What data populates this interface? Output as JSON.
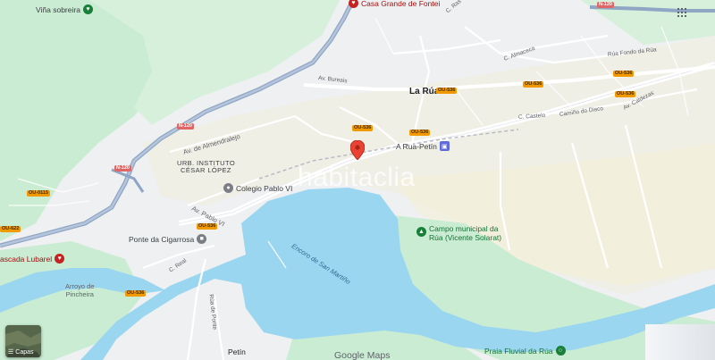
{
  "map": {
    "watermark": "habitaclia",
    "main_place": "La Rúa",
    "secondary_place": "Petín",
    "district": {
      "line1": "URB. INSTITUTO",
      "line2": "CÉSAR LÓPEZ"
    },
    "reservoir": "Encoro de San Martiño",
    "streets": [
      {
        "id": "av-bureais",
        "text": "Av. Bureais"
      },
      {
        "id": "av-almendralejo",
        "text": "Av. de Almendralejo"
      },
      {
        "id": "av-pablo-vi",
        "text": "Av. Pablo VI"
      },
      {
        "id": "c-almaceca",
        "text": "C. Almaceca"
      },
      {
        "id": "rua-fondo",
        "text": "Rúa Fondo da Rúa"
      },
      {
        "id": "c-castelo",
        "text": "C. Castelo"
      },
      {
        "id": "camino-disco",
        "text": "Camiño do Disco"
      },
      {
        "id": "av-caldezas",
        "text": "Av. Caldezas"
      },
      {
        "id": "c-real",
        "text": "C. Real"
      },
      {
        "id": "rua-ponte",
        "text": "Rúa de Ponte"
      },
      {
        "id": "c-ras",
        "text": "C. Ras"
      }
    ],
    "road_shields": [
      {
        "id": "n120-a",
        "text": "N-120",
        "color": "red"
      },
      {
        "id": "n120-b",
        "text": "N-120",
        "color": "red"
      },
      {
        "id": "n120-c",
        "text": "N-120",
        "color": "red"
      },
      {
        "id": "ou536-a",
        "text": "OU-536",
        "color": "orange"
      },
      {
        "id": "ou536-b",
        "text": "OU-536",
        "color": "orange"
      },
      {
        "id": "ou536-c",
        "text": "OU-536",
        "color": "orange"
      },
      {
        "id": "ou536-d",
        "text": "OU-536",
        "color": "orange"
      },
      {
        "id": "ou536-e",
        "text": "OU-536",
        "color": "orange"
      },
      {
        "id": "ou536-f",
        "text": "OU-536",
        "color": "orange"
      },
      {
        "id": "ou536-g",
        "text": "OU-536",
        "color": "orange"
      },
      {
        "id": "ou536-h",
        "text": "OU-536",
        "color": "orange"
      },
      {
        "id": "ou622",
        "text": "OU-622",
        "color": "orange"
      },
      {
        "id": "ou0115",
        "text": "OU-0115",
        "color": "orange"
      }
    ],
    "pois": [
      {
        "id": "vina-sobreira",
        "text": "Viña sobreira",
        "icon": "heart-pin",
        "color": "#188038"
      },
      {
        "id": "casa-grande",
        "text": "Casa Grande de Fontei",
        "icon": "heart-pin",
        "color": "#c5221f"
      },
      {
        "id": "a-rua-petin",
        "text": "A Rua-Petín",
        "icon": "train-icon",
        "color": "#5e6bd8"
      },
      {
        "id": "colegio",
        "text": "Colegio Pablo VI",
        "icon": "school-icon",
        "color": "#5f6368"
      },
      {
        "id": "campo",
        "text": "Campo municipal da Rúa (Vicente Solarat)",
        "line1": "Campo municipal da",
        "line2": "Rúa (Vicente Solarat)",
        "icon": "park-icon",
        "color": "#188038"
      },
      {
        "id": "ponte-cigarrosa",
        "text": "Ponte da Cigarrosa",
        "icon": "landmark-icon",
        "color": "#5f6368"
      },
      {
        "id": "fervenza",
        "text": "Fervenza Lubarel",
        "visible": "ascada Lubarel",
        "icon": "heart-pin",
        "color": "#c5221f"
      },
      {
        "id": "arroyo",
        "text": "Arroyo de Pincheira",
        "line1": "Arroyo de",
        "line2": "Pincheira",
        "icon": "none",
        "color": "#5f6368"
      },
      {
        "id": "praia",
        "text": "Praia Fluvial da Rúa",
        "icon": "beach-icon",
        "color": "#188038"
      }
    ],
    "layers_label": "Capas",
    "attribution": "Google Maps",
    "colors": {
      "land": "#eef0f2",
      "green": "#c9ecd3",
      "sand": "#f3efdd",
      "water": "#9bd6f1",
      "highway": "#8fa6c4",
      "road": "#ffffff",
      "marker": "#ea4335"
    }
  }
}
